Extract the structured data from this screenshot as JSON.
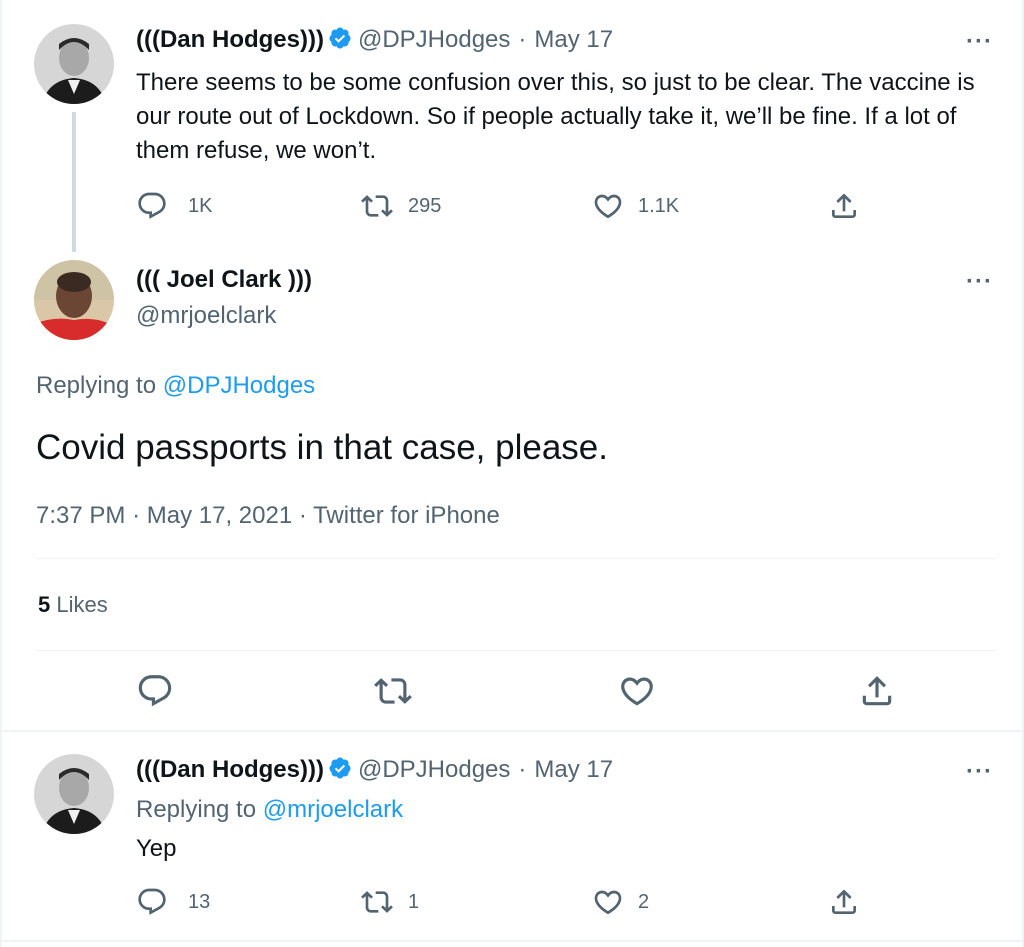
{
  "tweet1": {
    "name": "(((Dan Hodges)))",
    "handle": "@DPJHodges",
    "sep": "·",
    "date": "May 17",
    "text": "There seems to be some confusion over this, so just to be clear. The vaccine is our route out of Lockdown. So if people actually take it, we’ll be fine. If a lot of them refuse, we won’t.",
    "replies": "1K",
    "retweets": "295",
    "likes": "1.1K",
    "more": "···"
  },
  "main": {
    "name": "((( Joel Clark )))",
    "handle": "@mrjoelclark",
    "replying_prefix": "Replying to",
    "replying_to": "@DPJHodges",
    "text": "Covid passports in that case, please.",
    "time": "7:37 PM",
    "sep": "·",
    "date": "May 17, 2021",
    "source": "Twitter for iPhone",
    "likes_count": "5",
    "likes_label": "Likes",
    "more": "···"
  },
  "reply": {
    "name": "(((Dan Hodges)))",
    "handle": "@DPJHodges",
    "sep": "·",
    "date": "May 17",
    "replying_prefix": "Replying to",
    "replying_to": "@mrjoelclark",
    "text": "Yep",
    "replies": "13",
    "retweets": "1",
    "likes": "2",
    "more": "···"
  },
  "colors": {
    "accent": "#1d9bf0",
    "secondary": "#536471",
    "text": "#0f1419",
    "border": "#eff3f4"
  },
  "icons": [
    "verified-badge-icon",
    "reply-icon",
    "retweet-icon",
    "like-icon",
    "share-icon",
    "more-icon"
  ]
}
